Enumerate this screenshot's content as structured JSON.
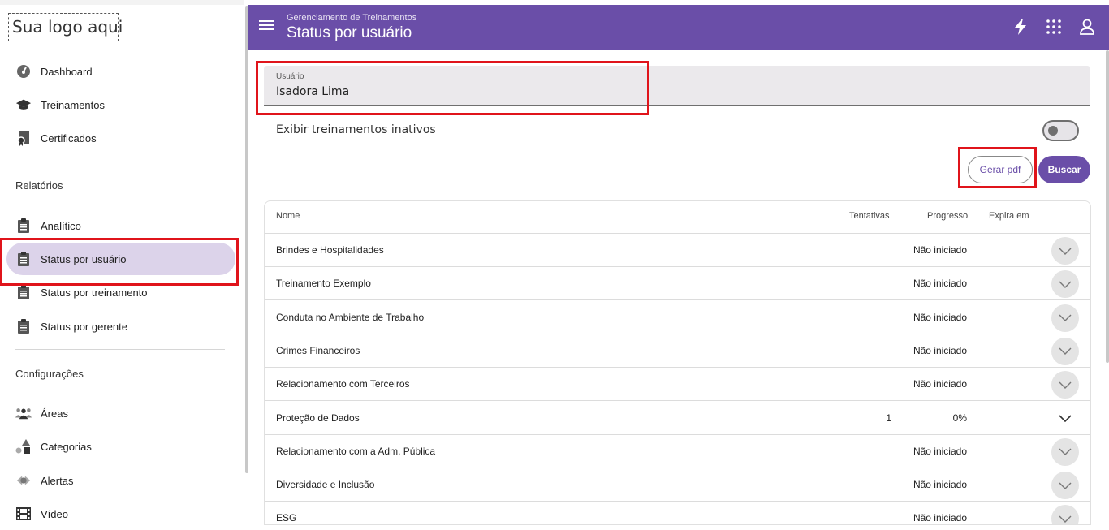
{
  "logo": {
    "text": "Sua logo aqui"
  },
  "sidebar": {
    "items": [
      {
        "label": "Dashboard",
        "icon": "dashboard-gauge-icon"
      },
      {
        "label": "Treinamentos",
        "icon": "graduation-cap-icon"
      },
      {
        "label": "Certificados",
        "icon": "certificate-icon"
      }
    ],
    "reports_title": "Relatórios",
    "reports": [
      {
        "label": "Analítico",
        "icon": "clipboard-icon"
      },
      {
        "label": "Status por usuário",
        "icon": "clipboard-icon",
        "active": true
      },
      {
        "label": "Status por treinamento",
        "icon": "clipboard-icon"
      },
      {
        "label": "Status por gerente",
        "icon": "clipboard-icon"
      }
    ],
    "config_title": "Configurações",
    "config": [
      {
        "label": "Áreas",
        "icon": "people-group-icon"
      },
      {
        "label": "Categorias",
        "icon": "shapes-icon"
      },
      {
        "label": "Alertas",
        "icon": "alert-icon"
      },
      {
        "label": "Vídeo",
        "icon": "film-icon"
      }
    ]
  },
  "appbar": {
    "subtitle": "Gerenciamento de Treinamentos",
    "title": "Status por usuário",
    "color": "#6a4ea8"
  },
  "form": {
    "user_label": "Usuário",
    "user_value": "Isadora Lima",
    "toggle_label": "Exibir treinamentos inativos",
    "toggle_on": false,
    "pdf_button": "Gerar pdf",
    "search_button": "Buscar"
  },
  "table": {
    "headers": {
      "name": "Nome",
      "attempts": "Tentativas",
      "progress": "Progresso",
      "expires": "Expira em"
    },
    "rows": [
      {
        "name": "Brindes e Hospitalidades",
        "attempts": "",
        "progress": "Não iniciado"
      },
      {
        "name": "Treinamento Exemplo",
        "attempts": "",
        "progress": "Não iniciado"
      },
      {
        "name": "Conduta no Ambiente de Trabalho",
        "attempts": "",
        "progress": "Não iniciado"
      },
      {
        "name": "Crimes Financeiros",
        "attempts": "",
        "progress": "Não iniciado"
      },
      {
        "name": "Relacionamento com Terceiros",
        "attempts": "",
        "progress": "Não iniciado"
      },
      {
        "name": "Proteção de Dados",
        "attempts": "1",
        "progress": "0%"
      },
      {
        "name": "Relacionamento com a Adm. Pública",
        "attempts": "",
        "progress": "Não iniciado"
      },
      {
        "name": "Diversidade e Inclusão",
        "attempts": "",
        "progress": "Não iniciado"
      },
      {
        "name": "ESG",
        "attempts": "",
        "progress": "Não iniciado"
      }
    ]
  }
}
